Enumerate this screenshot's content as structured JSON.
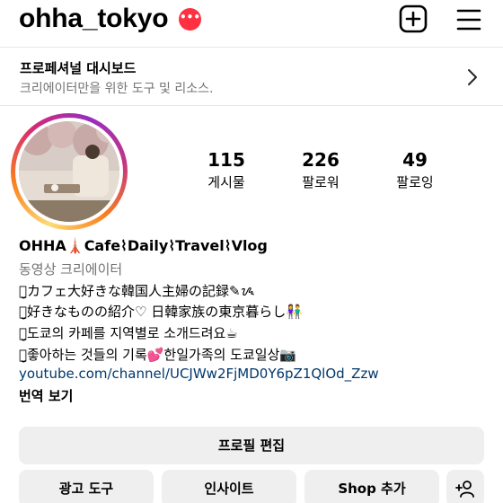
{
  "header": {
    "username": "ohha_tokyo",
    "badge": "•••"
  },
  "dashboard": {
    "title": "프로페셔널 대시보드",
    "subtitle": "크리에이터만을 위한 도구 및 리소스."
  },
  "stats": [
    {
      "value": "115",
      "label": "게시물"
    },
    {
      "value": "226",
      "label": "팔로워"
    },
    {
      "value": "49",
      "label": "팔로잉"
    }
  ],
  "bio": {
    "name": "OHHA🗼Cafe⌇Daily⌇Travel⌇Vlog",
    "category": "동영상 크리에이터",
    "lines": [
      "ꪔ̤̮カフェ大好きな韓国人主婦の記録✎ᝰ",
      "ꪔ̤̮好きなものの紹介♡ 日韓家族の東京暮らし👫",
      "ꪔ̤̮도쿄의 카페를 지역별로 소개드려요☕",
      "ꪔ̤̮좋아하는 것들의 기록💕한일가족의 도쿄일상📷"
    ],
    "link": "youtube.com/channel/UCJWw2FjMD0Y6pZ1QlOd_Zzw",
    "translate": "번역 보기"
  },
  "buttons": {
    "edit_profile": "프로필 편집",
    "ads_tools": "광고 도구",
    "insights": "인사이트",
    "add_shop": "Shop 추가"
  },
  "icons": {
    "add": "plus-square-icon",
    "menu": "hamburger-menu-icon",
    "chevron": "chevron-right-icon",
    "add_person": "add-person-icon"
  },
  "colors": {
    "badge": "#ff3040",
    "link": "#00376b",
    "secondary_text": "#737373",
    "button_bg": "#efefef"
  }
}
